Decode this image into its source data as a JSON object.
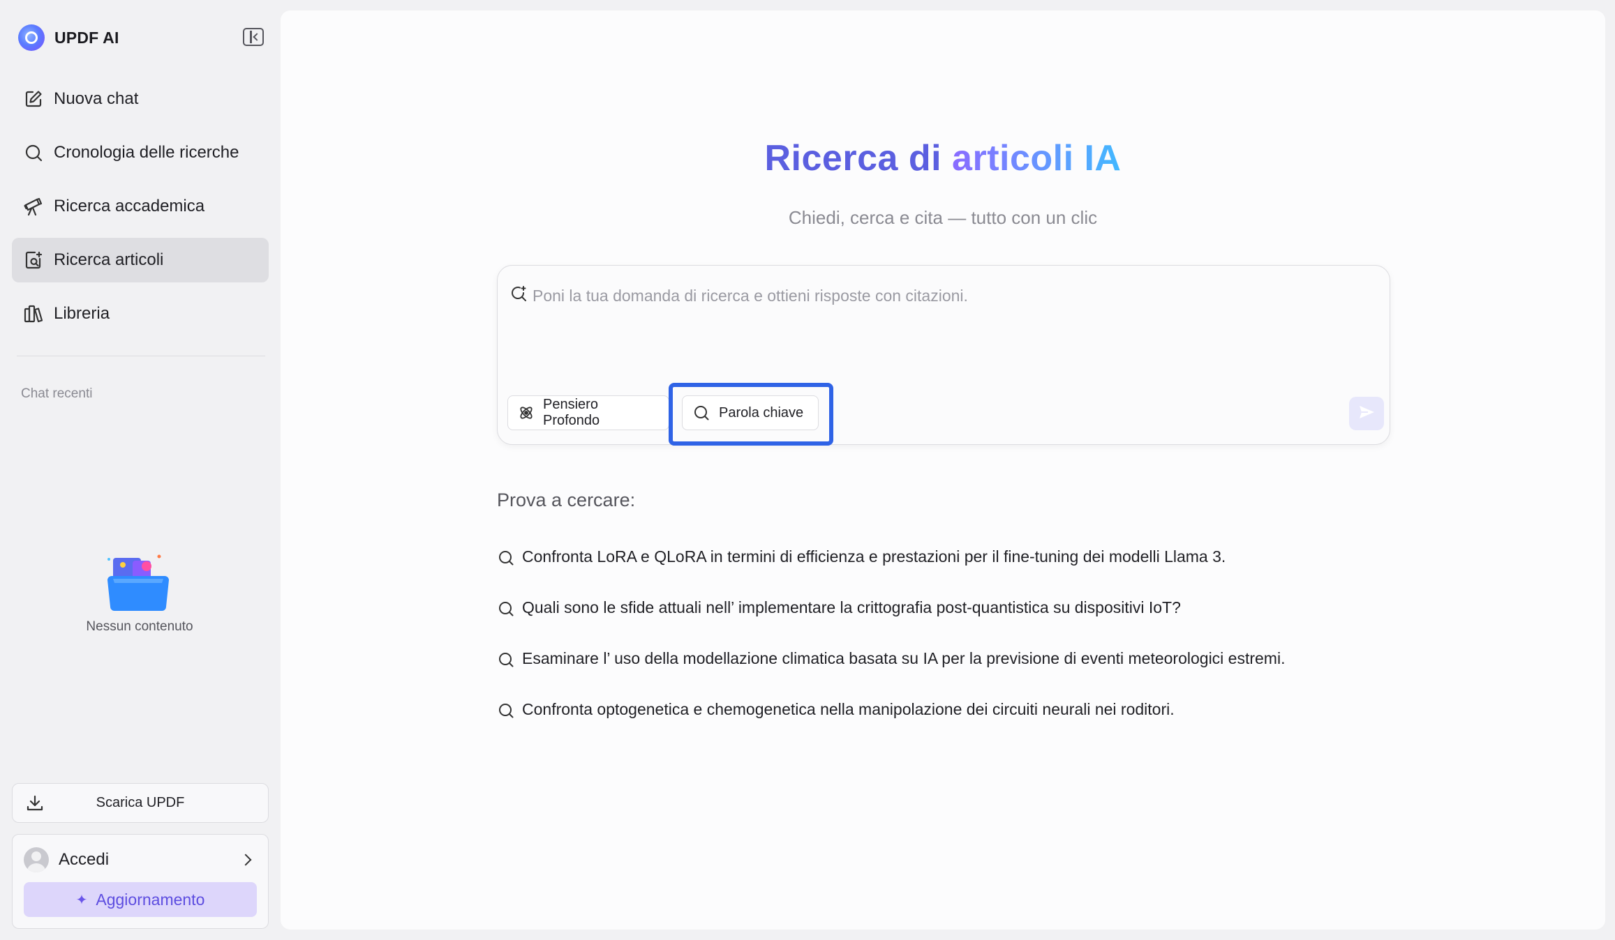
{
  "app": {
    "name": "UPDF AI"
  },
  "sidebar": {
    "nav": [
      {
        "label": "Nuova chat",
        "icon": "edit-icon"
      },
      {
        "label": "Cronologia delle ricerche",
        "icon": "search-icon"
      },
      {
        "label": "Ricerca accademica",
        "icon": "telescope-icon"
      },
      {
        "label": "Ricerca articoli",
        "icon": "document-search-icon",
        "active": true
      },
      {
        "label": "Libreria",
        "icon": "library-icon"
      }
    ],
    "recent_label": "Chat recenti",
    "empty_text": "Nessun contenuto",
    "download_label": "Scarica UPDF",
    "login_label": "Accedi",
    "upgrade_label": "Aggiornamento"
  },
  "main": {
    "title_part1": "Ricerca di ",
    "title_part2": "articoli IA",
    "subtitle": "Chiedi, cerca e cita — tutto con un clic",
    "query_placeholder": "Poni la tua domanda di ricerca e ottieni risposte con citazioni.",
    "chips": {
      "deep_thinking": "Pensiero Profondo",
      "keyword": "Parola chiave"
    },
    "try_label": "Prova a cercare:",
    "suggestions": [
      "Confronta LoRA e QLoRA in termini di efficienza e prestazioni per il fine-tuning dei modelli Llama 3.",
      "Quali sono le sfide attuali nell’ implementare la crittografia post-quantistica su dispositivi IoT?",
      "Esaminare l’ uso della modellazione climatica basata su IA per la previsione di eventi meteorologici estremi.",
      "Confronta optogenetica e chemogenetica nella manipolazione dei circuiti neurali nei roditori."
    ]
  },
  "colors": {
    "accent": "#5b5fe0",
    "highlight_border": "#2f63e6",
    "active_nav_bg": "#dedee2",
    "upgrade_bg": "#ddd6fb"
  }
}
